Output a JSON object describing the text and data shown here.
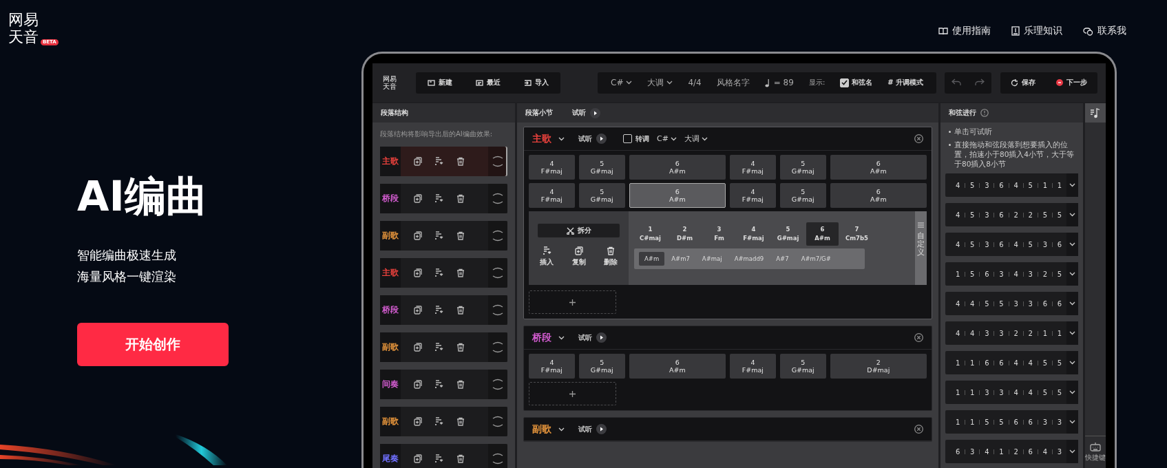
{
  "logo": {
    "line1": "网易",
    "line2": "天音",
    "badge": "BETA"
  },
  "nav": [
    {
      "label": "使用指南",
      "kind": "guide"
    },
    {
      "label": "乐理知识",
      "kind": "theory"
    },
    {
      "label": "联系我",
      "kind": "contact"
    }
  ],
  "hero": {
    "title": "AI编曲",
    "lines": [
      "智能编曲极速生成",
      "海量风格一键渲染"
    ],
    "cta": "开始创作"
  },
  "app": {
    "logo": {
      "line1": "网易",
      "line2": "天音"
    },
    "file_buttons": [
      {
        "label": "新建",
        "kind": "new"
      },
      {
        "label": "最近",
        "kind": "recent"
      },
      {
        "label": "导入",
        "kind": "import"
      }
    ],
    "settings": {
      "key": "C#",
      "mode": "大调",
      "meter": "4/4",
      "style": "风格名字",
      "tempo": "= 89",
      "display_label": "显示:",
      "chord_names": {
        "label": "和弦名",
        "checked": true
      },
      "sharp_mode": "# 升调模式"
    },
    "save": "保存",
    "next": "下一步",
    "structure": {
      "title": "段落结构",
      "hint": "段落结构将影响导出后的AI编曲效果:",
      "sections": [
        {
          "label": "主歌",
          "color": "#e8413c",
          "selected": true
        },
        {
          "label": "桥段",
          "color": "#d25ccf",
          "selected": false
        },
        {
          "label": "副歌",
          "color": "#e8963c",
          "selected": false
        },
        {
          "label": "主歌",
          "color": "#e8413c",
          "selected": false
        },
        {
          "label": "桥段",
          "color": "#d25ccf",
          "selected": false
        },
        {
          "label": "副歌",
          "color": "#e8963c",
          "selected": false
        },
        {
          "label": "间奏",
          "color": "#d25ccf",
          "selected": false
        },
        {
          "label": "副歌",
          "color": "#e8963c",
          "selected": false
        },
        {
          "label": "尾奏",
          "color": "#7070ff",
          "selected": false
        }
      ]
    },
    "bars": {
      "title": "段落小节",
      "listen": "试听",
      "sections": [
        {
          "label": "主歌",
          "color": "#e8413c",
          "selected": true,
          "listen": "试听",
          "transpose": {
            "label": "转调",
            "checked": false,
            "key": "C#",
            "mode": "大调"
          },
          "rows": [
            [
              {
                "degree": "4",
                "name": "F#maj",
                "selected": false
              },
              {
                "degree": "5",
                "name": "G#maj",
                "selected": false
              },
              {
                "degree": "6",
                "name": "A#m",
                "selected": false
              },
              {
                "degree": "4",
                "name": "F#maj",
                "selected": false
              },
              {
                "degree": "5",
                "name": "G#maj",
                "selected": false
              },
              {
                "degree": "6",
                "name": "A#m",
                "selected": false
              }
            ],
            [
              {
                "degree": "4",
                "name": "F#maj",
                "selected": false
              },
              {
                "degree": "5",
                "name": "G#maj",
                "selected": false
              },
              {
                "degree": "6",
                "name": "A#m",
                "selected": true
              },
              {
                "degree": "4",
                "name": "F#maj",
                "selected": false
              },
              {
                "degree": "5",
                "name": "G#maj",
                "selected": false
              },
              {
                "degree": "6",
                "name": "A#m",
                "selected": false
              }
            ]
          ],
          "popup": {
            "split": "拆分",
            "actions": [
              {
                "label": "插入",
                "kind": "insert"
              },
              {
                "label": "复制",
                "kind": "copy"
              },
              {
                "label": "删除",
                "kind": "delete"
              }
            ],
            "degrees": [
              {
                "degree": "1",
                "name": "C#maj",
                "selected": false
              },
              {
                "degree": "2",
                "name": "D#m",
                "selected": false
              },
              {
                "degree": "3",
                "name": "Fm",
                "selected": false
              },
              {
                "degree": "4",
                "name": "F#maj",
                "selected": false
              },
              {
                "degree": "5",
                "name": "G#maj",
                "selected": false
              },
              {
                "degree": "6",
                "name": "A#m",
                "selected": true
              },
              {
                "degree": "7",
                "name": "Cm7b5",
                "selected": false
              }
            ],
            "variants": [
              {
                "label": "A#m",
                "selected": true
              },
              {
                "label": "A#m7",
                "selected": false
              },
              {
                "label": "A#maj",
                "selected": false
              },
              {
                "label": "A#madd9",
                "selected": false
              },
              {
                "label": "A#7",
                "selected": false
              },
              {
                "label": "A#m7/G#",
                "selected": false
              }
            ],
            "custom": "自定义"
          }
        },
        {
          "label": "桥段",
          "color": "#d25ccf",
          "selected": false,
          "listen": "试听",
          "rows": [
            [
              {
                "degree": "4",
                "name": "F#maj",
                "selected": false
              },
              {
                "degree": "5",
                "name": "G#maj",
                "selected": false
              },
              {
                "degree": "6",
                "name": "A#m",
                "selected": false
              },
              {
                "degree": "4",
                "name": "F#maj",
                "selected": false
              },
              {
                "degree": "5",
                "name": "G#maj",
                "selected": false
              },
              {
                "degree": "2",
                "name": "D#maj",
                "selected": false
              }
            ]
          ]
        },
        {
          "label": "副歌",
          "color": "#e8963c",
          "selected": false,
          "listen": "试听"
        }
      ]
    },
    "progressions": {
      "title": "和弦进行",
      "notes": [
        "单击可试听",
        "直接拖动和弦段落到想要插入的位置，拍速小于80插入4小节，大于等于80插入8小节"
      ],
      "items": [
        [
          "4",
          "5",
          "3",
          "6",
          "4",
          "5",
          "1",
          "1"
        ],
        [
          "4",
          "5",
          "3",
          "6",
          "2",
          "2",
          "5",
          "5"
        ],
        [
          "4",
          "5",
          "3",
          "6",
          "4",
          "5",
          "3",
          "6"
        ],
        [
          "1",
          "5",
          "6",
          "3",
          "4",
          "3",
          "2",
          "5"
        ],
        [
          "4",
          "4",
          "5",
          "5",
          "3",
          "3",
          "6",
          "6"
        ],
        [
          "4",
          "4",
          "3",
          "3",
          "2",
          "2",
          "1",
          "1"
        ],
        [
          "1",
          "1",
          "6",
          "6",
          "4",
          "4",
          "5",
          "5"
        ],
        [
          "1",
          "1",
          "3",
          "3",
          "4",
          "4",
          "5",
          "5"
        ],
        [
          "1",
          "1",
          "5",
          "5",
          "6",
          "6",
          "3",
          "3"
        ],
        [
          "6",
          "3",
          "4",
          "1",
          "2",
          "6",
          "4",
          "3"
        ]
      ]
    },
    "shortcuts": "快捷键"
  }
}
